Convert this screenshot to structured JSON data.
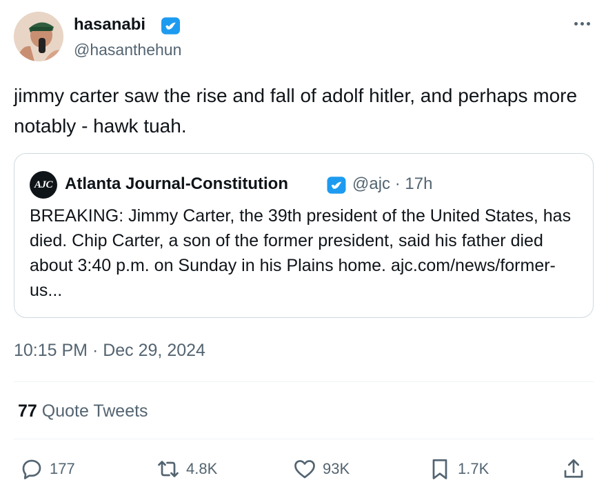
{
  "author": {
    "display_name": "hasanabi",
    "handle": "@hasanthehun",
    "verified_icon": "verified-badge-icon"
  },
  "tweet": {
    "text": "jimmy carter saw the rise and fall of adolf hitler, and perhaps more notably - hawk tuah.",
    "timestamp": "10:15 PM · Dec 29, 2024"
  },
  "quoted_tweet": {
    "avatar_text": "AJC",
    "display_name": "Atlanta Journal-Constitution",
    "handle_time": "@ajc · 17h",
    "text": "BREAKING: Jimmy Carter, the 39th president of the United States, has died. Chip Carter, a son of the former president, said his father died about 3:40 p.m. on Sunday in his Plains home. ajc.com/news/former-us..."
  },
  "quote_tweets": {
    "count": "77",
    "label": "Quote Tweets"
  },
  "actions": {
    "reply": "177",
    "retweet": "4.8K",
    "like": "93K",
    "bookmark": "1.7K"
  },
  "colors": {
    "text": "#0f1419",
    "secondary": "#536471",
    "verified": "#1d9bf0",
    "border": "#cfd9de"
  }
}
